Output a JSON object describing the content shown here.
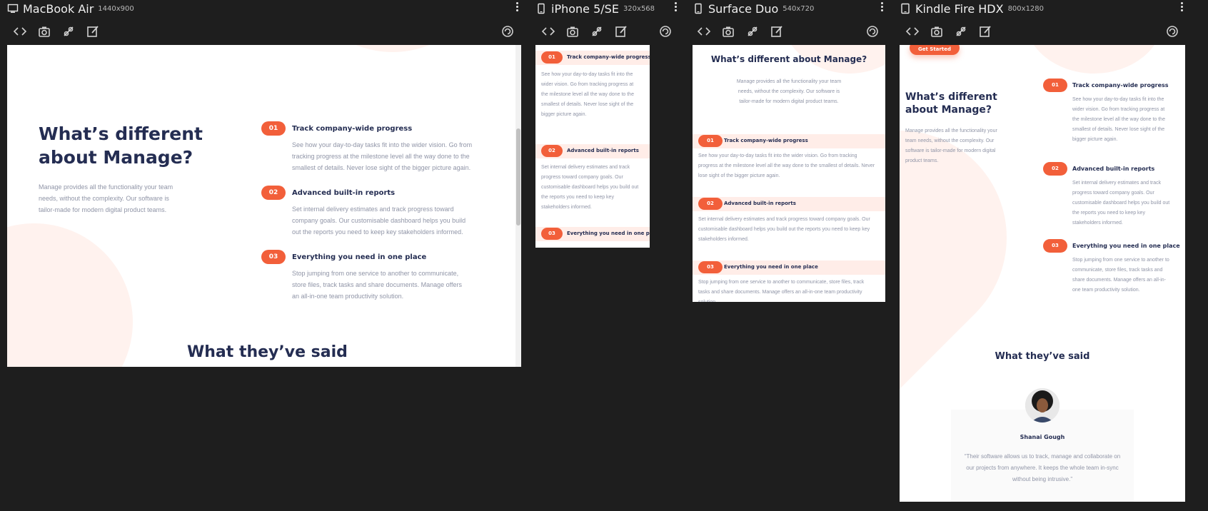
{
  "devices": [
    {
      "id": "macbook",
      "name": "MacBook Air",
      "size": "1440x900"
    },
    {
      "id": "iphone",
      "name": "iPhone 5/SE",
      "size": "320x568"
    },
    {
      "id": "surface",
      "name": "Surface Duo",
      "size": "540x720"
    },
    {
      "id": "kindle",
      "name": "Kindle Fire HDX",
      "size": "800x1280"
    }
  ],
  "toolbar_icons": [
    "code-icon",
    "camera-icon",
    "bug-icon",
    "edit-icon",
    "rotate-icon"
  ],
  "site": {
    "heading": "What’s different about Manage?",
    "intro": "Manage provides all the functionality your team needs, without the complexity. Our software is tailor-made for modern digital product teams.",
    "features": [
      {
        "num": "01",
        "title": "Track company-wide progress",
        "text": "See how your day-to-day tasks fit into the wider vision. Go from tracking progress at the milestone level all the way done to the smallest of details. Never lose sight of the bigger picture again."
      },
      {
        "num": "02",
        "title": "Advanced built-in reports",
        "text": "Set internal delivery estimates and track progress toward company goals. Our customisable dashboard helps you build out the reports you need to keep key stakeholders informed."
      },
      {
        "num": "03",
        "title": "Everything you need in one place",
        "text": "Stop jumping from one service to another to communicate, store files, track tasks and share documents. Manage offers an all-in-one team productivity solution."
      }
    ],
    "testimonials_heading": "What they’ve said",
    "get_started": "Get Started",
    "testimonial": {
      "name": "Shanai Gough",
      "quote": "“Their software allows us to track, manage and collaborate on our projects from anywhere. It keeps the whole team in-sync without being intrusive.”"
    }
  },
  "colors": {
    "accent": "#f25f3a",
    "dark_blue": "#242d52",
    "text_gray": "#9095a7",
    "blob": "#fff2ee",
    "band": "#ffede8",
    "chrome_bg": "#1e1e1e"
  }
}
